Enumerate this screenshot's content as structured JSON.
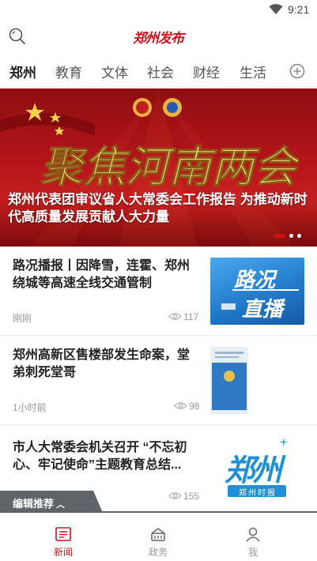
{
  "status_bar": {
    "time": "9:21",
    "wifi_icon": "wifi-icon"
  },
  "header": {
    "logo_text": "郑州发布",
    "search_icon": "search-icon"
  },
  "tabs": [
    {
      "label": "郑州",
      "active": true
    },
    {
      "label": "教育",
      "active": false
    },
    {
      "label": "文体",
      "active": false
    },
    {
      "label": "社会",
      "active": false
    },
    {
      "label": "财经",
      "active": false
    },
    {
      "label": "生活",
      "active": false
    }
  ],
  "tab_add_icon": "plus-circle-icon",
  "banner": {
    "title": "郑州代表团审议省人大常委会工作报告 为推动新时代高质量发展贡献人大力量",
    "art_text": "聚焦河南两会",
    "slide_count": 3,
    "active_slide": 1
  },
  "news": [
    {
      "title": "路况播报丨因降雪，连霍、郑州绕城等高速全线交通管制",
      "time": "刚刚",
      "views": "117",
      "thumb_line1": "路况",
      "thumb_line2": "直播"
    },
    {
      "title": "郑州高新区售楼部发生命案，堂弟刺死堂哥",
      "time": "1小时前",
      "views": "98"
    },
    {
      "title": "市人大常委会机关召开 “不忘初心、牢记使命”主题教育总结...",
      "time": "",
      "views": "155",
      "thumb_logo": "郑州",
      "thumb_sub": "郑州时报"
    }
  ],
  "editor_tag": {
    "label": "编辑推荐",
    "icon": "chevron-up-icon"
  },
  "bottom_nav": [
    {
      "label": "新闻",
      "icon": "news-icon",
      "active": true
    },
    {
      "label": "政务",
      "icon": "government-icon",
      "active": false
    },
    {
      "label": "我",
      "icon": "user-icon",
      "active": false
    }
  ],
  "colors": {
    "accent": "#d0111b",
    "banner_red": "#b3141a",
    "tag_gray": "#5f636a",
    "thumb_blue": "#1f78c8"
  }
}
